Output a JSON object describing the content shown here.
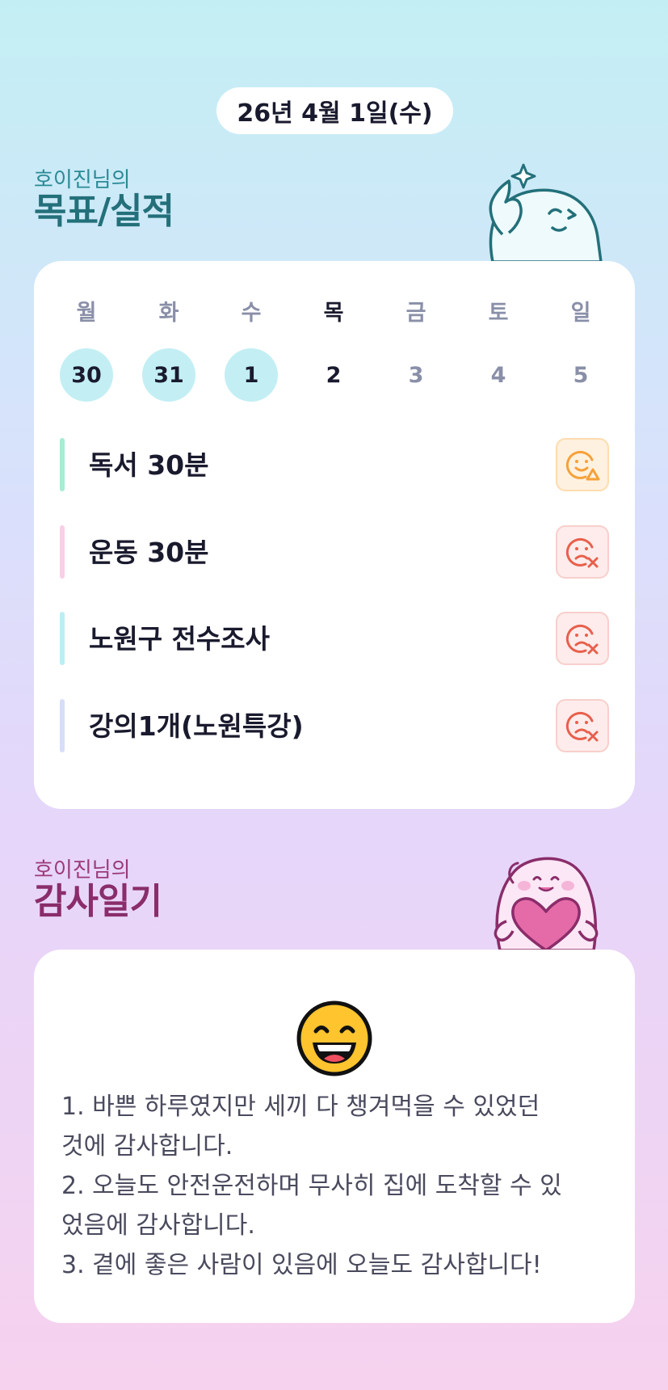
{
  "date_label": "26년 4월 1일(수)",
  "goals_section": {
    "owner": "호이진님의",
    "title": "목표/실적"
  },
  "week": {
    "days": [
      {
        "name": "월",
        "num": "30",
        "state": "done"
      },
      {
        "name": "화",
        "num": "31",
        "state": "done"
      },
      {
        "name": "수",
        "num": "1",
        "state": "done"
      },
      {
        "name": "목",
        "num": "2",
        "state": "today"
      },
      {
        "name": "금",
        "num": "3",
        "state": "future"
      },
      {
        "name": "토",
        "num": "4",
        "state": "future"
      },
      {
        "name": "일",
        "num": "5",
        "state": "future"
      }
    ]
  },
  "goals": [
    {
      "label": "독서 30분",
      "bar_color": "#a8ecd3",
      "status": "partial",
      "status_icon": "smile-triangle-icon"
    },
    {
      "label": "운동 30분",
      "bar_color": "#f9cfe6",
      "status": "fail",
      "status_icon": "sad-x-icon"
    },
    {
      "label": "노원구 전수조사",
      "bar_color": "#bdeef3",
      "status": "fail",
      "status_icon": "sad-x-icon"
    },
    {
      "label": "강의1개(노원특강)",
      "bar_color": "#d6def8",
      "status": "fail",
      "status_icon": "sad-x-icon"
    }
  ],
  "diary_section": {
    "owner": "호이진님의",
    "title": "감사일기",
    "mood_icon": "grinning-face-icon",
    "lines": [
      "1. 바쁜 하루였지만 세끼 다 챙겨먹을 수 있었던",
      "것에 감사합니다.",
      "2. 오늘도 안전운전하며 무사히 집에 도착할 수 있",
      "었음에 감사합니다.",
      "3. 곁에 좋은 사람이 있음에 오늘도 감사합니다!"
    ]
  },
  "colors": {
    "partial_accent": "#f5a13a",
    "fail_accent": "#e8604c",
    "done_day": "#c3eff4",
    "goals_title": "#23707a",
    "diary_title": "#8a2d6a"
  }
}
